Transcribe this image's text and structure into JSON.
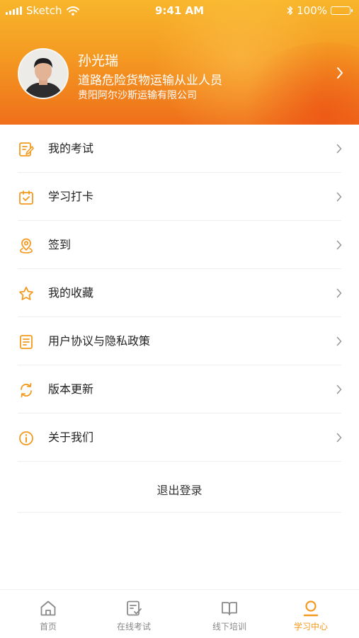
{
  "status_bar": {
    "carrier": "Sketch",
    "time": "9:41 AM",
    "battery": "100%"
  },
  "profile": {
    "name": "孙光瑞",
    "role": "道路危险货物运输从业人员",
    "company": "贵阳阿尔沙斯运输有限公司"
  },
  "menu": [
    {
      "label": "我的考试",
      "icon": "exam-edit-icon"
    },
    {
      "label": "学习打卡",
      "icon": "calendar-check-icon"
    },
    {
      "label": "签到",
      "icon": "location-pin-icon"
    },
    {
      "label": "我的收藏",
      "icon": "star-icon"
    },
    {
      "label": "用户协议与隐私政策",
      "icon": "document-icon"
    },
    {
      "label": "版本更新",
      "icon": "refresh-icon"
    },
    {
      "label": "关于我们",
      "icon": "info-icon"
    }
  ],
  "logout_label": "退出登录",
  "tabbar": [
    {
      "label": "首页",
      "icon": "home-icon",
      "active": false
    },
    {
      "label": "在线考试",
      "icon": "exam-check-icon",
      "active": false
    },
    {
      "label": "线下培训",
      "icon": "book-icon",
      "active": false
    },
    {
      "label": "学习中心",
      "icon": "user-icon",
      "active": true
    }
  ],
  "colors": {
    "accent": "#f39a1e",
    "header_top": "#f8b62b",
    "header_bottom": "#ef6f1a",
    "tab_inactive": "#888888"
  }
}
